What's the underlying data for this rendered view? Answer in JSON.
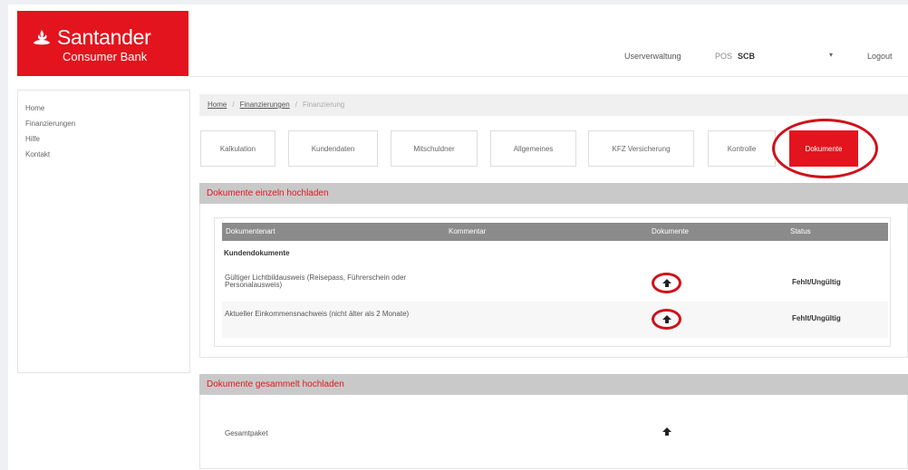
{
  "brand": {
    "name": "Santander",
    "sub": "Consumer Bank",
    "color": "#e3141d"
  },
  "topbar": {
    "userverwaltung": "Userverwaltung",
    "pos_label": "POS",
    "pos_value": "SCB",
    "caret_icon": "chevron-down-icon",
    "logout": "Logout"
  },
  "sidebar": {
    "items": [
      {
        "label": "Home"
      },
      {
        "label": "Finanzierungen"
      },
      {
        "label": "Hilfe"
      },
      {
        "label": "Kontakt"
      }
    ]
  },
  "breadcrumb": {
    "home": "Home",
    "finanzierungen": "Finanzierungen",
    "current": "Finanzierung"
  },
  "tabs": [
    {
      "label": "Kalkulation"
    },
    {
      "label": "Kundendaten"
    },
    {
      "label": "Mitschuldner"
    },
    {
      "label": "Allgemeines"
    },
    {
      "label": "KFZ Versicherung"
    },
    {
      "label": "Kontrolle"
    },
    {
      "label": "Dokumente",
      "active": true
    }
  ],
  "einzeln": {
    "title": "Dokumente einzeln hochladen",
    "headers": {
      "art": "Dokumentenart",
      "kommentar": "Kommentar",
      "dokumente": "Dokumente",
      "status": "Status"
    },
    "section": "Kundendokumente",
    "rows": [
      {
        "doc": "Gültiger Lichtbildausweis (Reisepass, Führerschein oder Personalausweis)",
        "status": "Fehlt/Ungültig",
        "icon": "upload-icon"
      },
      {
        "doc": "Aktueller Einkommensnachweis (nicht älter als 2 Monate)",
        "status": "Fehlt/Ungültig",
        "icon": "upload-icon"
      }
    ]
  },
  "gesammelt": {
    "title": "Dokumente gesammelt hochladen",
    "label": "Gesamtpaket",
    "icon": "upload-icon"
  },
  "highlight_color": "#d0101a"
}
